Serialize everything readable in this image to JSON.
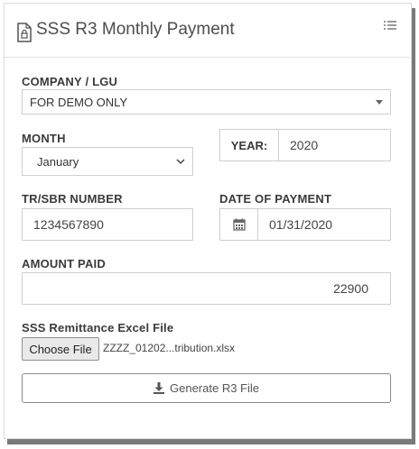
{
  "header": {
    "title": "SSS R3 Monthly Payment",
    "title_icon": "file-lock-icon",
    "menu_icon": "list-icon"
  },
  "company": {
    "label": "COMPANY / LGU",
    "selected": "FOR DEMO ONLY"
  },
  "month": {
    "label": "MONTH",
    "selected": "January"
  },
  "year": {
    "label": "YEAR:",
    "value": "2020"
  },
  "tr_sbr": {
    "label": "TR/SBR NUMBER",
    "value": "1234567890"
  },
  "date_of_payment": {
    "label": "DATE OF PAYMENT",
    "value": "01/31/2020",
    "icon": "calendar-icon"
  },
  "amount_paid": {
    "label": "AMOUNT PAID",
    "value": "22900"
  },
  "remittance_file": {
    "label": "SSS Remittance Excel File",
    "button_label": "Choose File",
    "file_name": "ZZZZ_01202...tribution.xlsx"
  },
  "generate": {
    "label": "Generate R3 File",
    "icon": "download-icon"
  },
  "colors": {
    "border": "#cfcfcf",
    "text": "#333333",
    "shadow": "#7a7a7a"
  }
}
